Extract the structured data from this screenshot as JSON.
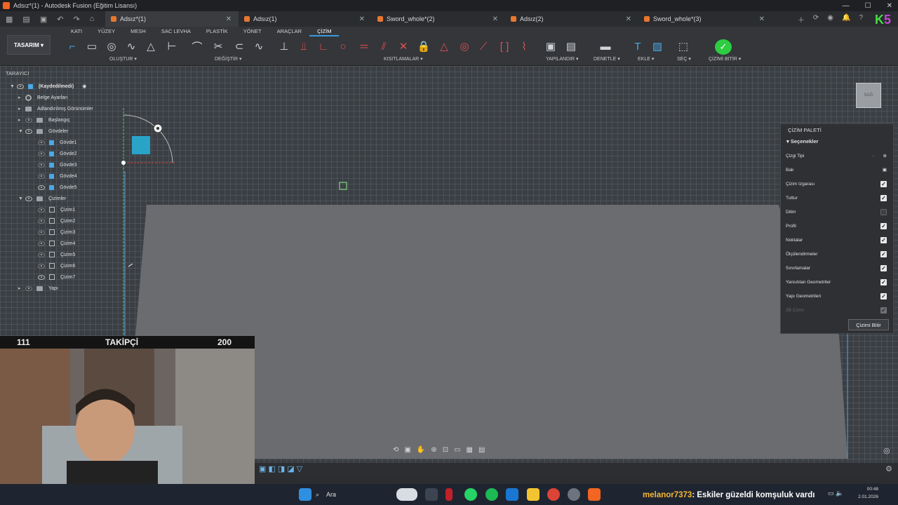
{
  "window": {
    "title": "Adsız*(1) - Autodesk Fusion (Eğitim Lisansı)"
  },
  "tabs": [
    {
      "label": "Adsız*(1)",
      "active": true
    },
    {
      "label": "Adsız(1)",
      "active": false
    },
    {
      "label": "Sword_whole*(2)",
      "active": false
    },
    {
      "label": "Adsız(2)",
      "active": false
    },
    {
      "label": "Sword_whole*(3)",
      "active": false
    }
  ],
  "overlay_logo": {
    "k": "K",
    "five": "5"
  },
  "toolbar": {
    "workspace": "TASARIM",
    "menu_tabs": [
      "KATI",
      "YÜZEY",
      "MESH",
      "SAC LEVHA",
      "PLASTİK",
      "YÖNET",
      "ARAÇLAR",
      "ÇİZİM"
    ],
    "active_menu_tab": "ÇİZİM",
    "groups": {
      "create": "OLUŞTUR",
      "modify": "DEĞİŞTİR",
      "constraints": "KISITLAMALAR",
      "configure": "YAPILANDIR",
      "inspect": "DENETLE",
      "insert": "EKLE",
      "select": "SEÇ",
      "finish": "ÇİZİMİ BİTİR"
    },
    "colors": {
      "accent": "#3a9bdc",
      "finish_green": "#2ecc40"
    }
  },
  "browser": {
    "header": "TARAYICI",
    "root": "(Kaydedilmedi)",
    "items": [
      {
        "label": "Belge Ayarları",
        "icon": "gear-icon"
      },
      {
        "label": "Adlandırılmış Görünümler",
        "icon": "folder-icon"
      },
      {
        "label": "Başlangıç",
        "icon": "folder-icon"
      },
      {
        "label": "Gövdeler",
        "icon": "folder-icon"
      },
      {
        "label": "Gövde1",
        "icon": "body-icon"
      },
      {
        "label": "Gövde2",
        "icon": "body-icon"
      },
      {
        "label": "Gövde3",
        "icon": "body-icon"
      },
      {
        "label": "Gövde4",
        "icon": "body-icon"
      },
      {
        "label": "Gövde5",
        "icon": "body-icon"
      },
      {
        "label": "Çizimler",
        "icon": "folder-icon"
      },
      {
        "label": "Çizim1",
        "icon": "sketch-icon"
      },
      {
        "label": "Çizim2",
        "icon": "sketch-icon"
      },
      {
        "label": "Çizim3",
        "icon": "sketch-icon"
      },
      {
        "label": "Çizim4",
        "icon": "sketch-icon"
      },
      {
        "label": "Çizim5",
        "icon": "sketch-icon"
      },
      {
        "label": "Çizim6",
        "icon": "sketch-icon"
      },
      {
        "label": "Çizim7",
        "icon": "sketch-icon"
      },
      {
        "label": "Yapı",
        "icon": "folder-icon"
      }
    ]
  },
  "palette": {
    "title": "ÇİZİM PALETİ",
    "section": "Seçenekler",
    "options": [
      {
        "label": "Çizgi Tipi",
        "state": "icons"
      },
      {
        "label": "Bak",
        "state": "icon"
      },
      {
        "label": "Çizim Izgarası",
        "state": "on"
      },
      {
        "label": "Tuttur",
        "state": "on"
      },
      {
        "label": "Dilim",
        "state": "off"
      },
      {
        "label": "Profil",
        "state": "on"
      },
      {
        "label": "Noktalar",
        "state": "on"
      },
      {
        "label": "Ölçülendirmeler",
        "state": "on"
      },
      {
        "label": "Sınırlamalar",
        "state": "on"
      },
      {
        "label": "Yansıtılan Geometriler",
        "state": "on"
      },
      {
        "label": "Yapı Geometrileri",
        "state": "on"
      },
      {
        "label": "3B Çizim",
        "state": "disabled"
      }
    ],
    "finish_button": "Çizimi Bitir"
  },
  "viewcube": {
    "label": "SAĞ"
  },
  "follower_bar": {
    "left": "111",
    "center": "TAKİPÇİ",
    "right": "200"
  },
  "taskbar": {
    "search_label": "Ara",
    "chat_user": "melanor7373",
    "chat_message": ": Eskiler güzeldi komşuluk vardı",
    "time": "00:48",
    "date": "2.01.2026"
  }
}
